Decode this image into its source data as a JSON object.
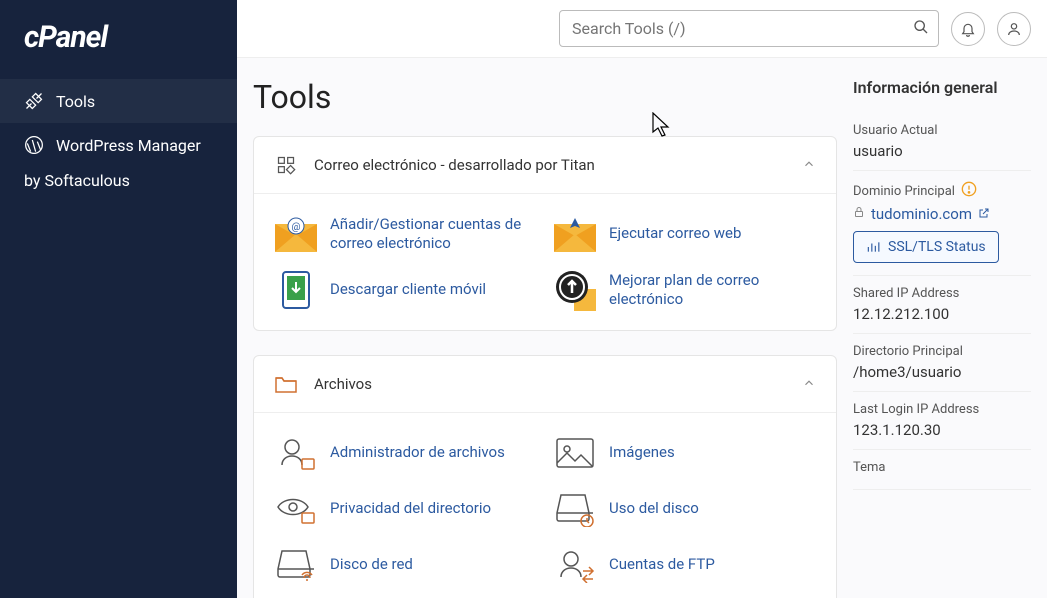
{
  "sidebar": {
    "logo": "cPanel",
    "items": [
      {
        "label": "Tools"
      },
      {
        "label": "WordPress Manager",
        "sub": "by Softaculous"
      }
    ]
  },
  "search": {
    "placeholder": "Search Tools (/)"
  },
  "page_title": "Tools",
  "panels": [
    {
      "title": "Correo electrónico - desarrollado por Titan",
      "tools": [
        "Añadir/Gestionar cuentas de correo electrónico",
        "Ejecutar correo web",
        "Descargar cliente móvil",
        "Mejorar plan de correo electrónico"
      ]
    },
    {
      "title": "Archivos",
      "tools": [
        "Administrador de archivos",
        "Imágenes",
        "Privacidad del directorio",
        "Uso del disco",
        "Disco de red",
        "Cuentas de FTP"
      ]
    }
  ],
  "info": {
    "title": "Información general",
    "user_label": "Usuario Actual",
    "user_value": "usuario",
    "domain_label": "Dominio Principal",
    "domain_value": "tudominio.com",
    "ssl_btn": "SSL/TLS Status",
    "ip_label": "Shared IP Address",
    "ip_value": "12.12.212.100",
    "dir_label": "Directorio Principal",
    "dir_value": "/home3/usuario",
    "login_label": "Last Login IP Address",
    "login_value": "123.1.120.30",
    "theme_label": "Tema"
  }
}
